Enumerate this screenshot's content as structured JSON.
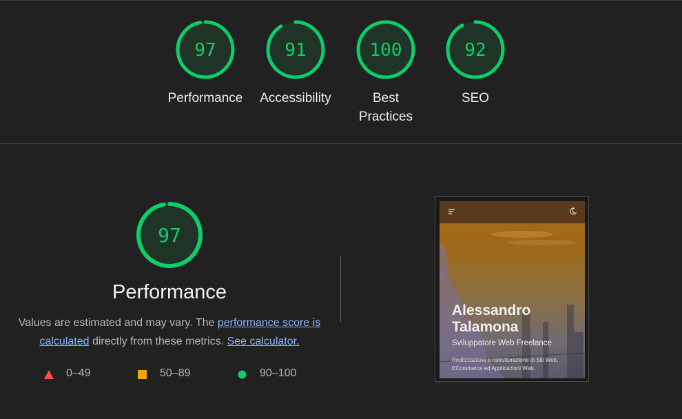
{
  "categories": [
    {
      "score": "97",
      "fraction": 0.97,
      "label": "Performance",
      "color": "#0cce6b"
    },
    {
      "score": "91",
      "fraction": 0.91,
      "label": "Accessibility",
      "color": "#0cce6b"
    },
    {
      "score": "100",
      "fraction": 1.0,
      "label": "Best Practices",
      "color": "#0cce6b"
    },
    {
      "score": "92",
      "fraction": 0.92,
      "label": "SEO",
      "color": "#0cce6b"
    }
  ],
  "performance": {
    "score": "97",
    "fraction": 0.97,
    "title": "Performance",
    "desc_prefix": "Values are estimated and may vary. The ",
    "score_link": "performance score is calculated",
    "desc_middle": " directly from these metrics. ",
    "calc_link": "See calculator."
  },
  "legend": [
    {
      "range": "0–49",
      "icon": "red-triangle-icon",
      "color": "#ff4e42"
    },
    {
      "range": "50–89",
      "icon": "orange-square-icon",
      "color": "#ffa400"
    },
    {
      "range": "90–100",
      "icon": "green-circle-icon",
      "color": "#0cce6b"
    }
  ],
  "screenshot": {
    "name": "Alessandro Talamona",
    "subtitle": "Sviluppatore Web Freelance",
    "description": "Realizzazione e ristrutturazione di Siti Web, ECommerce ed Applicazioni Web."
  },
  "colors": {
    "background": "#212121",
    "pass": "#0cce6b",
    "gauge_fill": "#1f3327",
    "link": "#8ab4f8"
  }
}
